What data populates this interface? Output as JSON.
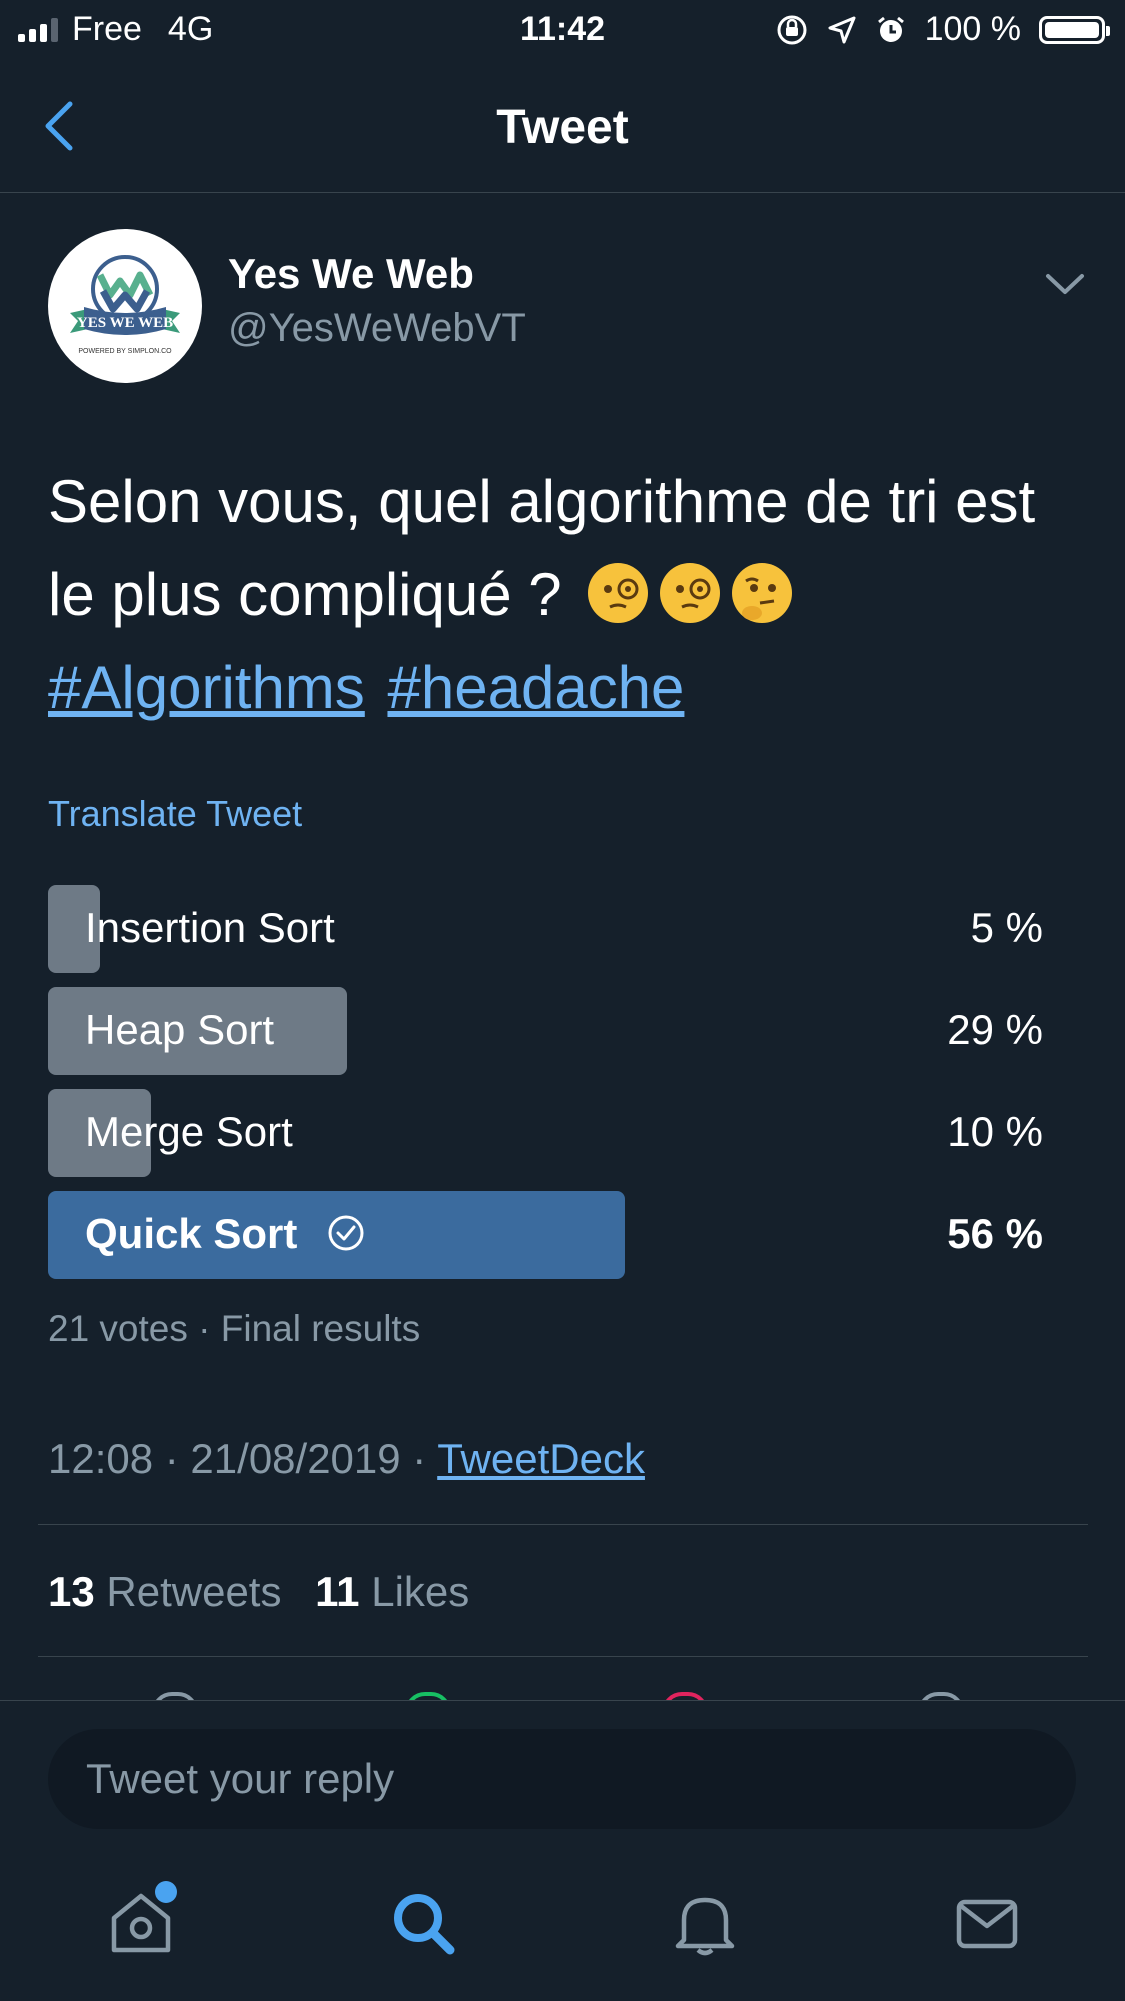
{
  "status_bar": {
    "carrier": "Free",
    "network": "4G",
    "time": "11:42",
    "battery": "100 %"
  },
  "nav": {
    "title": "Tweet"
  },
  "author": {
    "name": "Yes We Web",
    "handle": "@YesWeWebVT",
    "avatar_text": "YES WE WEB",
    "avatar_subtext": "POWERED BY SIMPLON.CO"
  },
  "tweet": {
    "text_line1": "Selon vous, quel algorithme de tri est",
    "text_line2": "le plus compliqué ?",
    "hashtags": [
      "#Algorithms",
      "#headache"
    ],
    "translate_label": "Translate Tweet"
  },
  "poll": {
    "options": [
      {
        "label": "Insertion Sort",
        "percent": "5 %",
        "value": 5,
        "winner": false
      },
      {
        "label": "Heap Sort",
        "percent": "29 %",
        "value": 29,
        "winner": false
      },
      {
        "label": "Merge Sort",
        "percent": "10 %",
        "value": 10,
        "winner": false
      },
      {
        "label": "Quick Sort",
        "percent": "56 %",
        "value": 56,
        "winner": true
      }
    ],
    "meta": "21 votes · Final results"
  },
  "timestamp": {
    "text": "12:08 · 21/08/2019 · ",
    "source": "TweetDeck"
  },
  "stats": {
    "retweets_count": "13",
    "retweets_label": "Retweets",
    "likes_count": "11",
    "likes_label": "Likes"
  },
  "reply": {
    "placeholder": "Tweet your reply"
  },
  "colors": {
    "background": "#15202b",
    "accent": "#6fb3f2",
    "winner_bar": "#3b6b9e",
    "bar": "#6e7a86",
    "muted": "#8899a6"
  },
  "icons": {
    "tabs": [
      "home-icon",
      "search-icon",
      "bell-icon",
      "mail-icon"
    ]
  }
}
